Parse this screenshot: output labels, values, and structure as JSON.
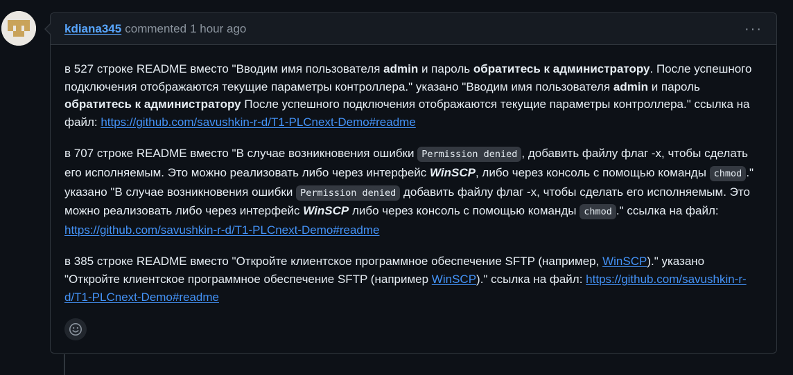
{
  "comment": {
    "author": "kdiana345",
    "verb": "commented",
    "time": "1 hour ago",
    "more_label": "···",
    "paragraphs": [
      {
        "t1": "в 527 строке README вместо \"Вводим имя пользователя ",
        "b1": "admin",
        "t2": " и пароль ",
        "b2": "обратитесь к администратору",
        "t3": ". После успешного подключения отображаются текущие параметры контроллера.\" указано \"Вводим имя пользователя ",
        "b3": "admin",
        "t4": " и пароль ",
        "b4": "обратитесь к администратору",
        "t5": " После успешного подключения отображаются текущие параметры контроллера.\" ссылка на файл: ",
        "link": "https://github.com/savushkin-r-d/T1-PLCnext-Demo#readme"
      },
      {
        "t1": "в 707 строке README вместо \"В случае возникновения ошибки ",
        "c1": "Permission denied",
        "t2": ", добавить файлу флаг -x, чтобы сделать его исполняемым. Это можно реализовать либо через интерфейс ",
        "e1": "WinSCP",
        "t3": ", либо через консоль с помощью команды ",
        "c2": "chmod",
        "t4": ".\" указано \"В случае возникновения ошибки ",
        "c3": "Permission denied",
        "t5": " добавить файлу флаг -x, чтобы сделать его исполняемым. Это можно реализовать либо через интерфейс ",
        "e2": "WinSCP",
        "t6": " либо через консоль с помощью команды ",
        "c4": "chmod",
        "t7": ".\" ссылка на файл: ",
        "link": "https://github.com/savushkin-r-d/T1-PLCnext-Demo#readme"
      },
      {
        "t1": "в 385 строке README вместо \"Откройте клиентское программное обеспечение SFTP (например, ",
        "l1": "WinSCP",
        "t2": ").\" указано \"Откройте клиентское программное обеспечение SFTP (например ",
        "l2": "WinSCP",
        "t3": ").\" ссылка на файл: ",
        "link": "https://github.com/savushkin-r-d/T1-PLCnext-Demo#readme"
      }
    ]
  },
  "icons": {
    "avatar": "identicon-avatar",
    "more": "kebab-horizontal-icon",
    "reaction": "smiley-icon"
  },
  "colors": {
    "background": "#0d1117",
    "header_bg": "#161b22",
    "border": "#30363d",
    "link": "#4493f8",
    "muted": "#8b949e",
    "text": "#e6edf3"
  }
}
